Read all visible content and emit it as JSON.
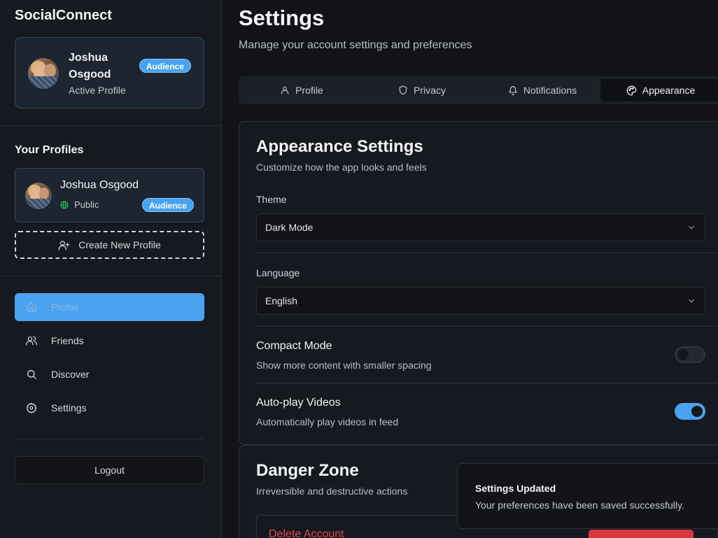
{
  "app": {
    "brand": "SocialConnect"
  },
  "active_profile": {
    "name": "Joshua Osgood",
    "status": "Active Profile",
    "badge": "Audience"
  },
  "profiles_section": {
    "title": "Your Profiles",
    "items": [
      {
        "name": "Joshua Osgood",
        "visibility": "Public",
        "badge": "Audience"
      }
    ],
    "create_label": "Create New Profile"
  },
  "nav": {
    "items": [
      {
        "label": "Profile",
        "icon": "home-icon",
        "active": true
      },
      {
        "label": "Friends",
        "icon": "users-icon",
        "active": false
      },
      {
        "label": "Discover",
        "icon": "search-icon",
        "active": false
      },
      {
        "label": "Settings",
        "icon": "gear-icon",
        "active": false
      }
    ],
    "logout_label": "Logout"
  },
  "header": {
    "title": "Settings",
    "subtitle": "Manage your account settings and preferences"
  },
  "tabs": [
    {
      "label": "Profile",
      "icon": "user-icon",
      "active": false
    },
    {
      "label": "Privacy",
      "icon": "shield-icon",
      "active": false
    },
    {
      "label": "Notifications",
      "icon": "bell-icon",
      "active": false
    },
    {
      "label": "Appearance",
      "icon": "palette-icon",
      "active": true
    }
  ],
  "appearance": {
    "title": "Appearance Settings",
    "subtitle": "Customize how the app looks and feels",
    "theme": {
      "label": "Theme",
      "value": "Dark Mode"
    },
    "language": {
      "label": "Language",
      "value": "English"
    },
    "compact_mode": {
      "title": "Compact Mode",
      "description": "Show more content with smaller spacing",
      "enabled": false
    },
    "autoplay": {
      "title": "Auto-play Videos",
      "description": "Automatically play videos in feed",
      "enabled": true
    }
  },
  "danger_zone": {
    "title": "Danger Zone",
    "subtitle": "Irreversible and destructive actions",
    "delete_label": "Delete Account"
  },
  "toast": {
    "title": "Settings Updated",
    "message": "Your preferences have been saved successfully."
  },
  "colors": {
    "accent": "#4aa3f0",
    "background": "#111318",
    "sidebar": "#16191f",
    "danger": "#e5484d",
    "public_indicator": "#22c55e"
  }
}
